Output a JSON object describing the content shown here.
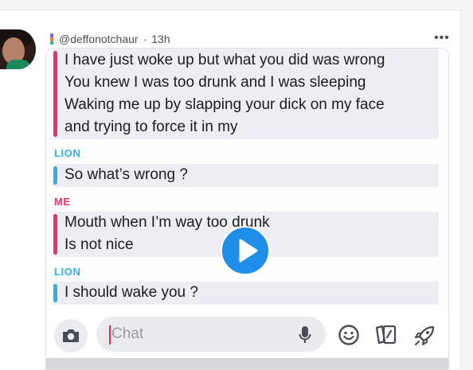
{
  "post": {
    "username": "@deffonotchaur",
    "separator": "·",
    "time": "13h",
    "more": "•••"
  },
  "snap": {
    "messages": [
      {
        "sender": "",
        "lines": [
          "I have just woke up but what you did was wrong",
          "You knew I was too drunk and I was sleeping",
          "Waking me up by slapping your dick on my face",
          "and trying to force it in my"
        ],
        "color": "#e5336b"
      },
      {
        "sender": "LION",
        "lines": [
          "So what’s wrong ?"
        ],
        "color": "#2fb1e8"
      },
      {
        "sender": "ME",
        "lines": [
          "Mouth when I’m way too drunk",
          "Is not nice"
        ],
        "color": "#e5336b"
      },
      {
        "sender": "LION",
        "lines": [
          "I should wake you ?"
        ],
        "color": "#2fb1e8"
      }
    ],
    "chat_placeholder": "Chat"
  },
  "colors": {
    "me": "#e5336b",
    "lion": "#2fb1e8",
    "play_button": "#1f8ee8"
  },
  "icons": [
    "camera-icon",
    "microphone-icon",
    "emoji-icon",
    "stickers-icon",
    "rocket-icon",
    "play-icon",
    "more-icon"
  ]
}
